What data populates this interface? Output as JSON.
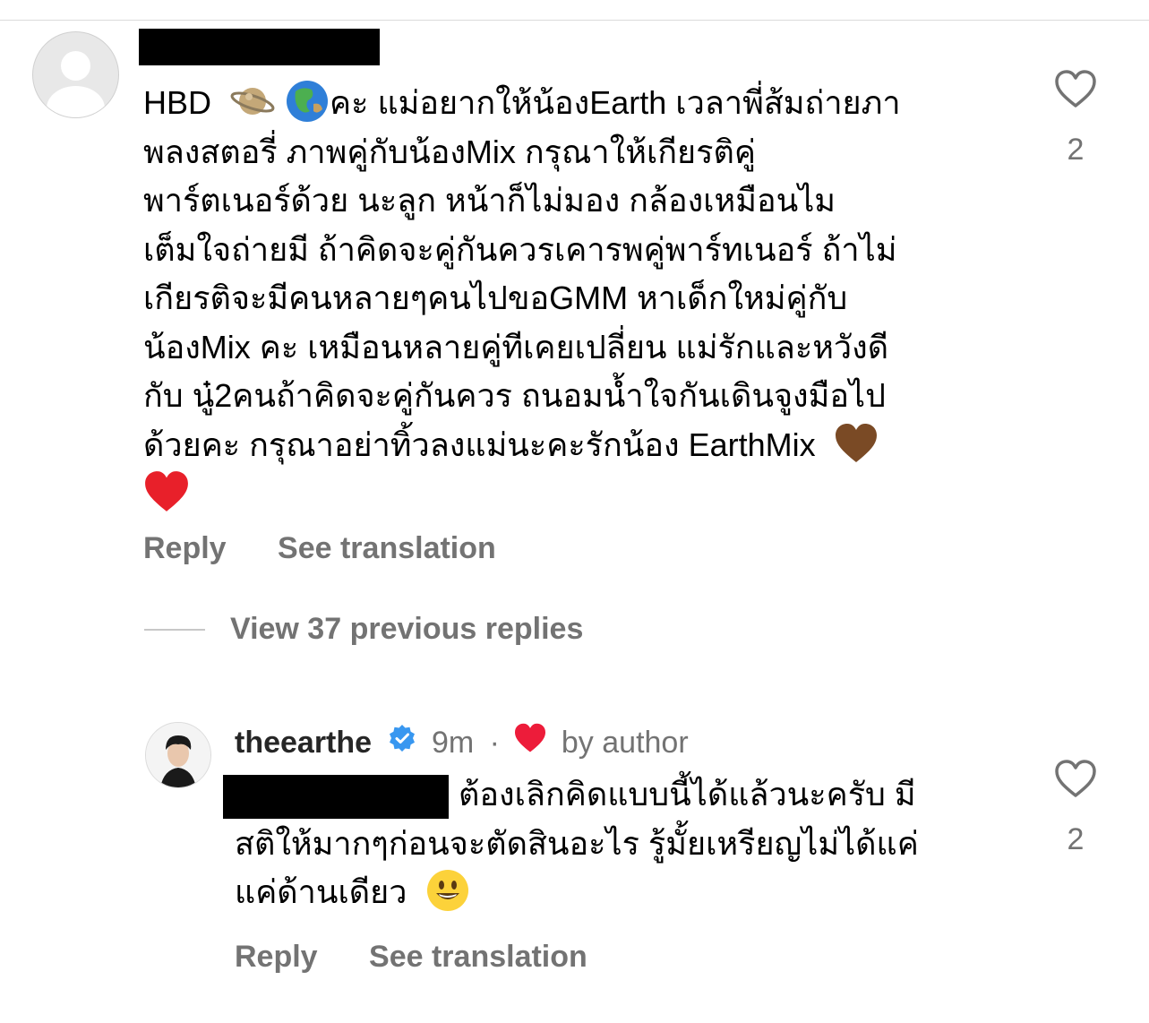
{
  "comment": {
    "text_lines": [
      "HBD",
      "คะ แม่อยากให้น้องEarth เวลาพี่ส้มถ่ายภา",
      "พลงสตอรี่ ภาพคู่กับน้องMix กรุณาให้เกียรติคู่",
      "พาร์ตเนอร์ด้วย นะลูก หน้าก็ไม่มอง กล้องเหมือนไม",
      "เต็มใจถ่ายมี ถ้าคิดจะคู่กันควรเคารพคู่พาร์ทเนอร์ ถ้าไม่",
      "เกียรติจะมีคนหลายๆคนไปขอGMM หาเด็กใหม่คู่กับ",
      "น้องMix คะ เหมือนหลายคู่ทีเคยเปลี่ยน แม่รักและหวังดี",
      "กับ นู๋2คนถ้าคิดจะคู่กันควร ถนอมน้ำใจกันเดินจูงมือไป",
      "ด้วยคะ กรุณาอย่าทิ้วลงแม่นะคะรักน้อง EarthMix"
    ],
    "emojis": [
      "ringed-planet-emoji",
      "globe-asia-emoji",
      "brown-heart-emoji",
      "red-heart-emoji"
    ],
    "reply_label": "Reply",
    "translate_label": "See translation",
    "like_count": "2"
  },
  "view_replies_label": "View 37 previous replies",
  "reply": {
    "username": "theearthe",
    "time": "9m",
    "separator": "·",
    "by_author_label": "by author",
    "text_lines": [
      "ต้องเลิกคิดแบบนี้ได้แล้วนะครับ มี",
      "สติให้มากๆก่อนจะตัดสินอะไร รู้มั้ยเหรียญไม่ได้แค่",
      "แค่ด้านเดียว"
    ],
    "emojis": [
      "smiley-emoji"
    ],
    "reply_label": "Reply",
    "translate_label": "See translation",
    "like_count": "2"
  },
  "colors": {
    "text": "#000000",
    "secondary": "#737373",
    "verified": "#3897f0",
    "heart": "#ed4956",
    "divider": "#dbdbdb"
  }
}
